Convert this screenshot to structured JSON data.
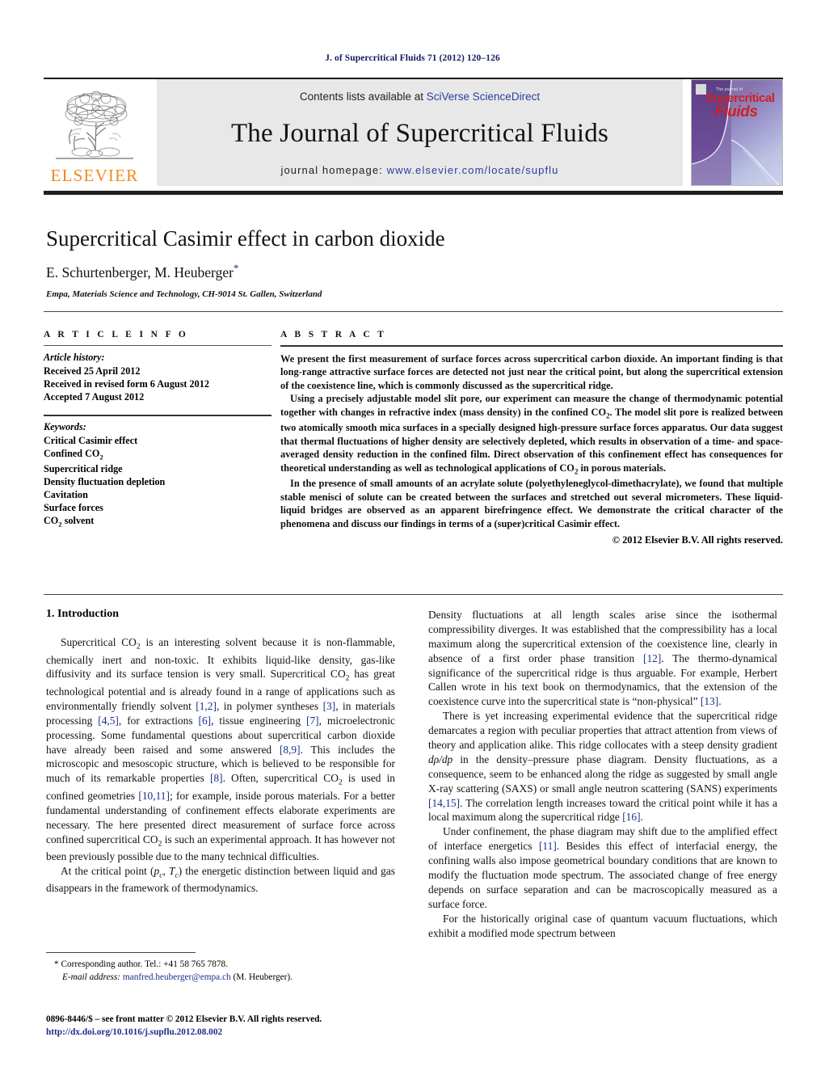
{
  "running_head": "J. of Supercritical Fluids 71 (2012) 120–126",
  "masthead": {
    "publisher_name": "ELSEVIER",
    "contents_prefix": "Contents lists available at ",
    "contents_link": "SciVerse ScienceDirect",
    "journal_title": "The Journal of Supercritical Fluids",
    "homepage_label": "journal homepage: ",
    "homepage_url": "www.elsevier.com/locate/supflu",
    "cover": {
      "tagline": "The journal of",
      "word1": "Supercritical",
      "word2": "Fluids"
    }
  },
  "title_block": {
    "title": "Supercritical Casimir effect in carbon dioxide",
    "authors": "E. Schurtenberger, M. Heuberger",
    "corresponding_marker": "*",
    "affiliation": "Empa, Materials Science and Technology, CH-9014 St. Gallen, Switzerland"
  },
  "article_info": {
    "label": "A R T I C L E   I N F O",
    "history_title": "Article history:",
    "history": [
      "Received 25 April 2012",
      "Received in revised form 6 August 2012",
      "Accepted 7 August 2012"
    ],
    "keywords_title": "Keywords:",
    "keywords": [
      "Critical Casimir effect",
      "Confined CO2",
      "Supercritical ridge",
      "Density fluctuation depletion",
      "Cavitation",
      "Surface forces",
      "CO2 solvent"
    ]
  },
  "abstract": {
    "label": "A B S T R A C T",
    "paragraphs": [
      "We present the first measurement of surface forces across supercritical carbon dioxide. An important finding is that long-range attractive surface forces are detected not just near the critical point, but along the supercritical extension of the coexistence line, which is commonly discussed as the supercritical ridge.",
      "Using a precisely adjustable model slit pore, our experiment can measure the change of thermodynamic potential together with changes in refractive index (mass density) in the confined CO2. The model slit pore is realized between two atomically smooth mica surfaces in a specially designed high-pressure surface forces apparatus. Our data suggest that thermal fluctuations of higher density are selectively depleted, which results in observation of a time- and space-averaged density reduction in the confined film. Direct observation of this confinement effect has consequences for theoretical understanding as well as technological applications of CO2 in porous materials.",
      "In the presence of small amounts of an acrylate solute (polyethyleneglycol-dimethacrylate), we found that multiple stable menisci of solute can be created between the surfaces and stretched out several micrometers. These liquid-liquid bridges are observed as an apparent birefringence effect. We demonstrate the critical character of the phenomena and discuss our findings in terms of a (super)critical Casimir effect."
    ],
    "copyright": "© 2012 Elsevier B.V. All rights reserved."
  },
  "body": {
    "section_heading": "1. Introduction",
    "left_paragraphs": [
      "Supercritical CO2 is an interesting solvent because it is non-flammable, chemically inert and non-toxic. It exhibits liquid-like density, gas-like diffusivity and its surface tension is very small. Supercritical CO2 has great technological potential and is already found in a range of applications such as environmentally friendly solvent [1,2], in polymer syntheses [3], in materials processing [4,5], for extractions [6], tissue engineering [7], microelectronic processing. Some fundamental questions about supercritical carbon dioxide have already been raised and some answered [8,9]. This includes the microscopic and mesoscopic structure, which is believed to be responsible for much of its remarkable properties [8]. Often, supercritical CO2 is used in confined geometries [10,11]; for example, inside porous materials. For a better fundamental understanding of confinement effects elaborate experiments are necessary. The here presented direct measurement of surface force across confined supercritical CO2 is such an experimental approach. It has however not been previously possible due to the many technical difficulties.",
      "At the critical point (pc, Tc) the energetic distinction between liquid and gas disappears in the framework of thermodynamics."
    ],
    "right_paragraphs": [
      "Density fluctuations at all length scales arise since the isothermal compressibility diverges. It was established that the compressibility has a local maximum along the supercritical extension of the coexistence line, clearly in absence of a first order phase transition [12]. The thermo-dynamical significance of the supercritical ridge is thus arguable. For example, Herbert Callen wrote in his text book on thermodynamics, that the extension of the coexistence curve into the supercritical state is “non-physical” [13].",
      "There is yet increasing experimental evidence that the supercritical ridge demarcates a region with peculiar properties that attract attention from views of theory and application alike. This ridge collocates with a steep density gradient dρ/dp in the density–pressure phase diagram. Density fluctuations, as a consequence, seem to be enhanced along the ridge as suggested by small angle X-ray scattering (SAXS) or small angle neutron scattering (SANS) experiments [14,15]. The correlation length increases toward the critical point while it has a local maximum along the supercritical ridge [16].",
      "Under confinement, the phase diagram may shift due to the amplified effect of interface energetics [11]. Besides this effect of interfacial energy, the confining walls also impose geometrical boundary conditions that are known to modify the fluctuation mode spectrum. The associated change of free energy depends on surface separation and can be macroscopically measured as a surface force.",
      "For the historically original case of quantum vacuum fluctuations, which exhibit a modified mode spectrum between"
    ]
  },
  "footnotes": {
    "corresponding": "* Corresponding author. Tel.: +41 58 765 7878.",
    "email_label": "E-mail address:",
    "email": "manfred.heuberger@empa.ch",
    "email_suffix": "(M. Heuberger).",
    "front_matter": "0896-8446/$ – see front matter © 2012 Elsevier B.V. All rights reserved.",
    "doi": "http://dx.doi.org/10.1016/j.supflu.2012.08.002"
  },
  "colors": {
    "link": "#1b2f8a",
    "running_head": "#141b64",
    "elsevier_orange": "#f08a1b",
    "cover_red": "#cf1f24",
    "banner_bg": "#e8e8e9"
  }
}
